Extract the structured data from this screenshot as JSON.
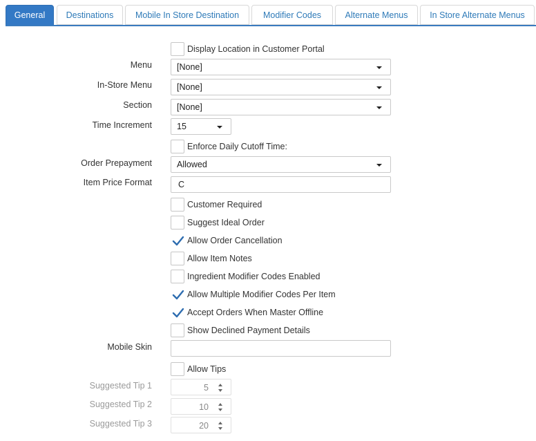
{
  "tabs": [
    {
      "label": "General",
      "active": true
    },
    {
      "label": "Destinations"
    },
    {
      "label": "Mobile In Store Destination"
    },
    {
      "label": "Modifier Codes"
    },
    {
      "label": "Alternate Menus"
    },
    {
      "label": "In Store Alternate Menus"
    }
  ],
  "form": {
    "display_location": {
      "label": "Display Location in Customer Portal",
      "checked": false
    },
    "menu": {
      "label": "Menu",
      "value": "[None]"
    },
    "in_store_menu": {
      "label": "In-Store Menu",
      "value": "[None]"
    },
    "section": {
      "label": "Section",
      "value": "[None]"
    },
    "time_increment": {
      "label": "Time Increment",
      "value": "15"
    },
    "enforce_cutoff": {
      "label": "Enforce Daily Cutoff Time:",
      "checked": false
    },
    "order_prepayment": {
      "label": "Order Prepayment",
      "value": "Allowed"
    },
    "item_price_format": {
      "label": "Item Price Format",
      "value": "C"
    },
    "checkboxes": [
      {
        "label": "Customer Required",
        "checked": false
      },
      {
        "label": "Suggest Ideal Order",
        "checked": false
      },
      {
        "label": "Allow Order Cancellation",
        "checked": true
      },
      {
        "label": "Allow Item Notes",
        "checked": false
      },
      {
        "label": "Ingredient Modifier Codes Enabled",
        "checked": false
      },
      {
        "label": "Allow Multiple Modifier Codes Per Item",
        "checked": true
      },
      {
        "label": "Accept Orders When Master Offline",
        "checked": true
      },
      {
        "label": "Show Declined Payment Details",
        "checked": false
      }
    ],
    "mobile_skin": {
      "label": "Mobile Skin",
      "value": ""
    },
    "allow_tips": {
      "label": "Allow Tips",
      "checked": false
    },
    "tips": [
      {
        "label": "Suggested Tip 1",
        "value": "5"
      },
      {
        "label": "Suggested Tip 2",
        "value": "10"
      },
      {
        "label": "Suggested Tip 3",
        "value": "20"
      }
    ]
  },
  "colors": {
    "accent": "#3379c5",
    "check": "#2e6db0"
  }
}
